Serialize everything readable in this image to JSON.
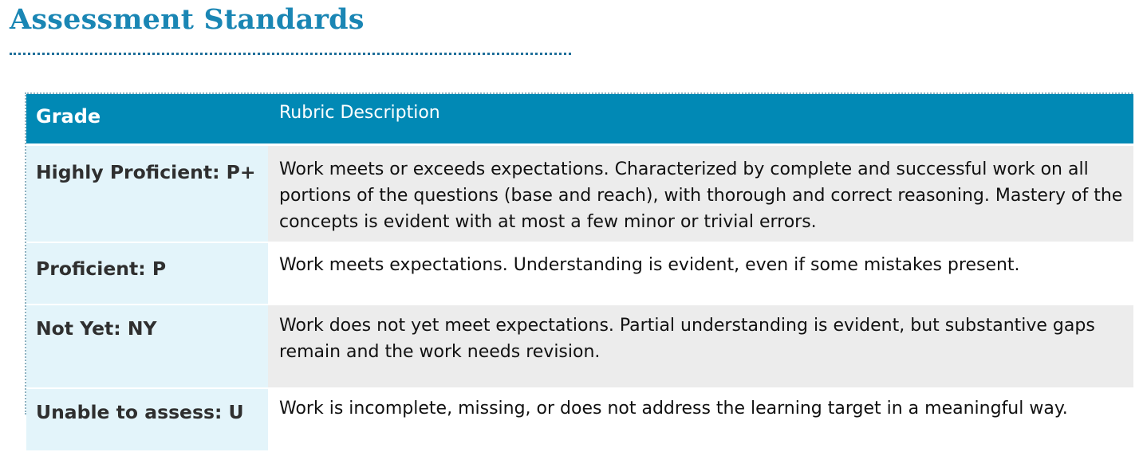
{
  "page": {
    "title": "Assessment Standards"
  },
  "rubric": {
    "headers": {
      "grade": "Grade",
      "description": "Rubric Description"
    },
    "rows": [
      {
        "grade": "Highly Proficient: P+",
        "description": "Work meets or exceeds expectations.  Characterized by complete and successful work on all portions of the questions (base and reach), with thorough and correct reasoning.  Mastery of the concepts is evident with at most a few minor or trivial errors."
      },
      {
        "grade": "Proficient: P",
        "description": "Work meets expectations. Understanding is evident, even if some mistakes present."
      },
      {
        "grade": "Not Yet: NY",
        "description": "Work does not yet meet expectations.  Partial understanding is evident, but substantive gaps remain and the work needs revision."
      },
      {
        "grade": "Unable to assess: U",
        "description": "Work is incomplete, missing, or does not address the learning target in a meaningful way."
      }
    ]
  },
  "colors": {
    "title": "#1a86b4",
    "header_background": "#0189b5",
    "grade_column_background": "#e3f4fa",
    "shaded_row_background": "#ececec"
  }
}
